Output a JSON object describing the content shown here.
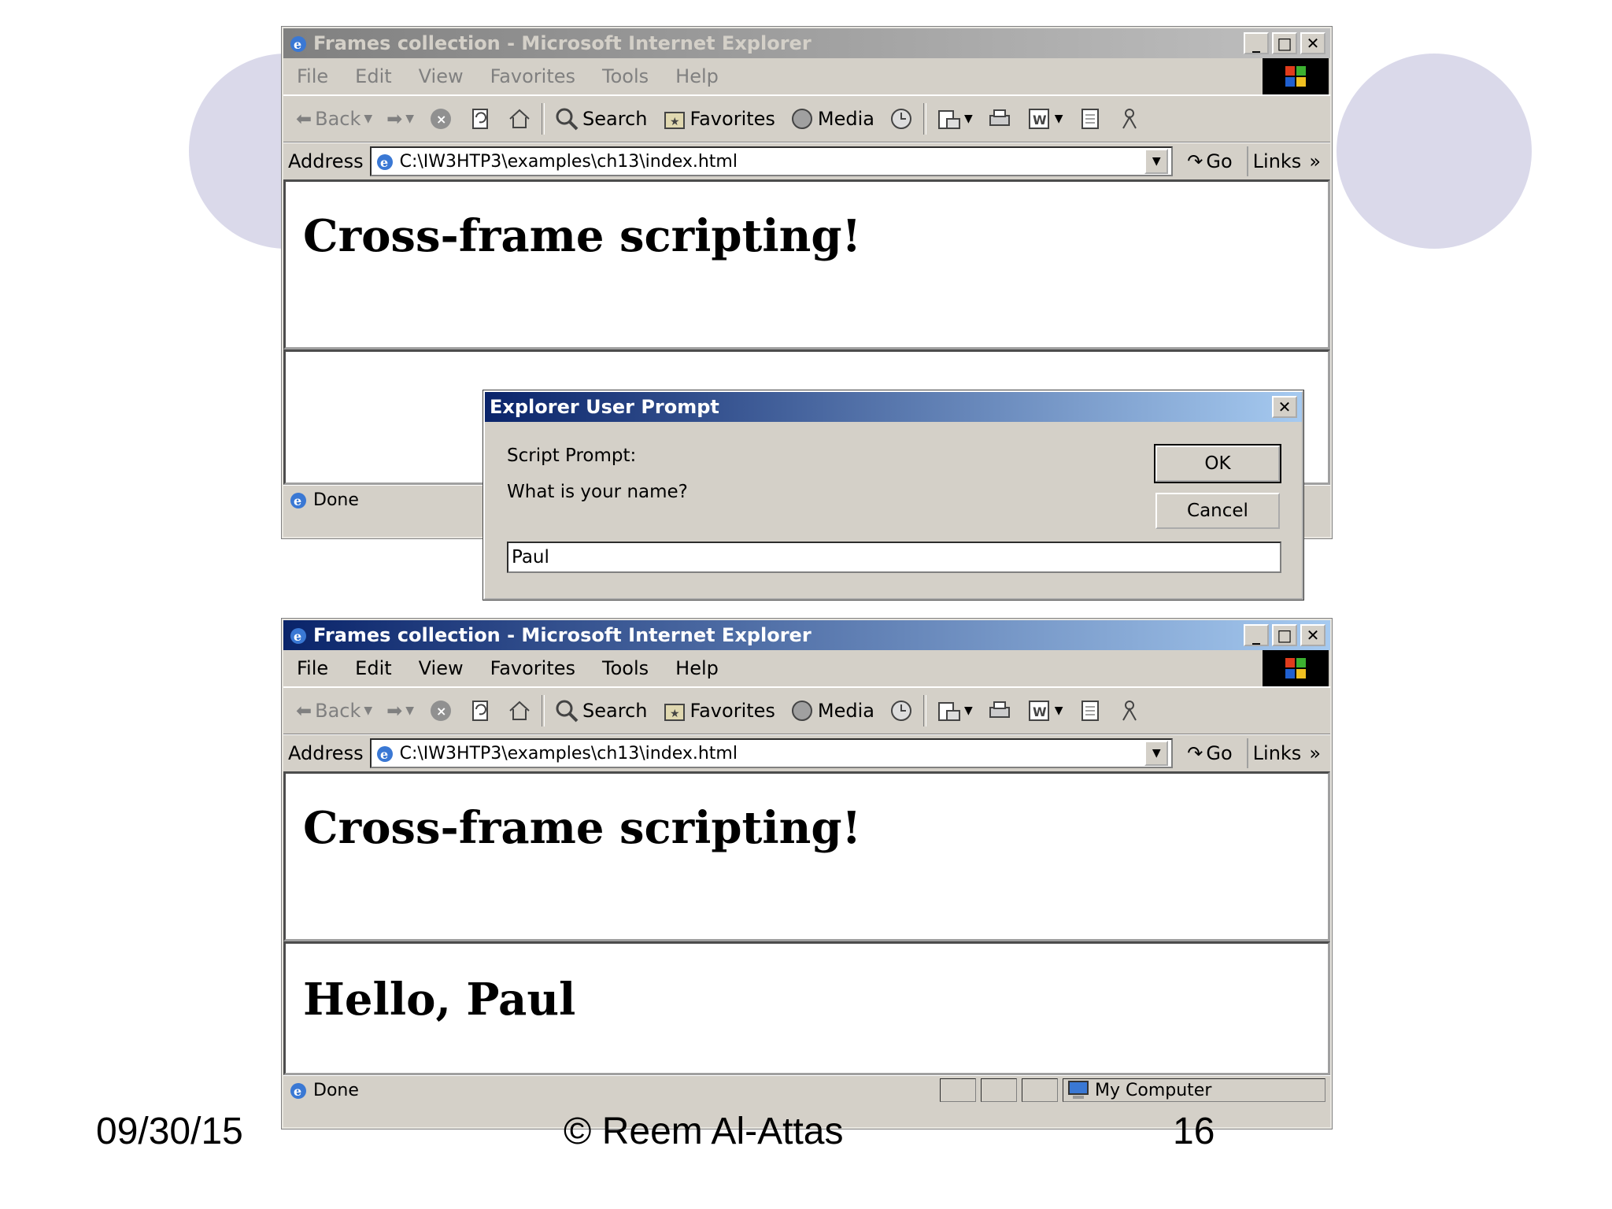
{
  "slide": {
    "date": "09/30/15",
    "copyright": "© Reem Al-Attas",
    "page_number": "16"
  },
  "window_top": {
    "title": "Frames collection - Microsoft Internet Explorer",
    "menu": [
      "File",
      "Edit",
      "View",
      "Favorites",
      "Tools",
      "Help"
    ],
    "toolbar": {
      "back": "Back",
      "search": "Search",
      "favorites": "Favorites",
      "media": "Media"
    },
    "address_label": "Address",
    "address_value": "C:\\IW3HTP3\\examples\\ch13\\index.html",
    "go_label": "Go",
    "links_label": "Links",
    "links_more": "»",
    "top_frame_heading": "Cross-frame scripting!",
    "status": "Done"
  },
  "prompt_dialog": {
    "title": "Explorer User Prompt",
    "script_prompt": "Script Prompt:",
    "question": "What is your name?",
    "ok": "OK",
    "cancel": "Cancel",
    "input_value": "Paul"
  },
  "window_bottom": {
    "title": "Frames collection - Microsoft Internet Explorer",
    "menu": [
      "File",
      "Edit",
      "View",
      "Favorites",
      "Tools",
      "Help"
    ],
    "toolbar": {
      "back": "Back",
      "search": "Search",
      "favorites": "Favorites",
      "media": "Media"
    },
    "address_label": "Address",
    "address_value": "C:\\IW3HTP3\\examples\\ch13\\index.html",
    "go_label": "Go",
    "links_label": "Links",
    "links_more": "»",
    "top_frame_heading": "Cross-frame scripting!",
    "bottom_frame_heading": "Hello, Paul",
    "status": "Done",
    "zone": "My Computer"
  }
}
